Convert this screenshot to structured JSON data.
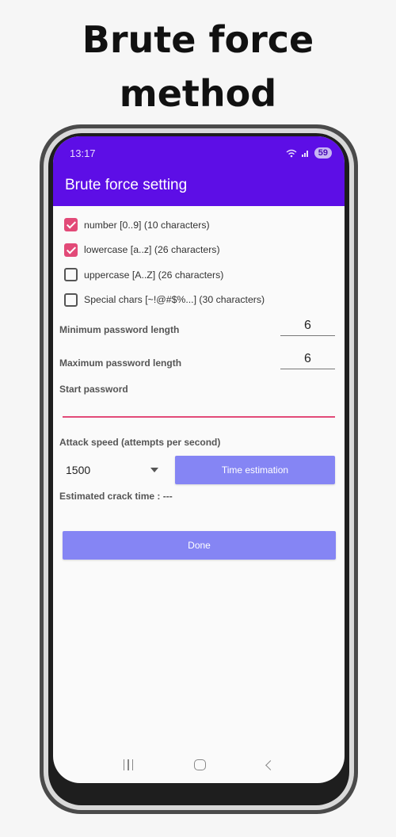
{
  "headline": {
    "line1": "Brute force",
    "line2": "method"
  },
  "status_bar": {
    "time": "13:17",
    "battery": "59"
  },
  "app_bar": {
    "title": "Brute force setting"
  },
  "charsets": [
    {
      "label": "number [0..9] (10 characters)",
      "checked": true
    },
    {
      "label": "lowercase [a..z] (26 characters)",
      "checked": true
    },
    {
      "label": "uppercase [A..Z] (26 characters)",
      "checked": false
    },
    {
      "label": "Special chars [~!@#$%...] (30 characters)",
      "checked": false
    }
  ],
  "min_length": {
    "label": "Minimum password length",
    "value": "6"
  },
  "max_length": {
    "label": "Maximum password length",
    "value": "6"
  },
  "start_password": {
    "label": "Start password",
    "value": ""
  },
  "attack_speed": {
    "label": "Attack speed (attempts per second)",
    "selected": "1500"
  },
  "buttons": {
    "time_estimation": "Time estimation",
    "done": "Done"
  },
  "estimate": {
    "label": "Estimated crack time : ---"
  },
  "colors": {
    "accent": "#5d0ee6",
    "checkbox": "#e24a78",
    "button": "#8585f4"
  },
  "icons": {
    "recents": "recents-icon",
    "home": "home-icon",
    "back": "back-icon",
    "wifi": "wifi-icon",
    "signal": "signal-icon"
  }
}
